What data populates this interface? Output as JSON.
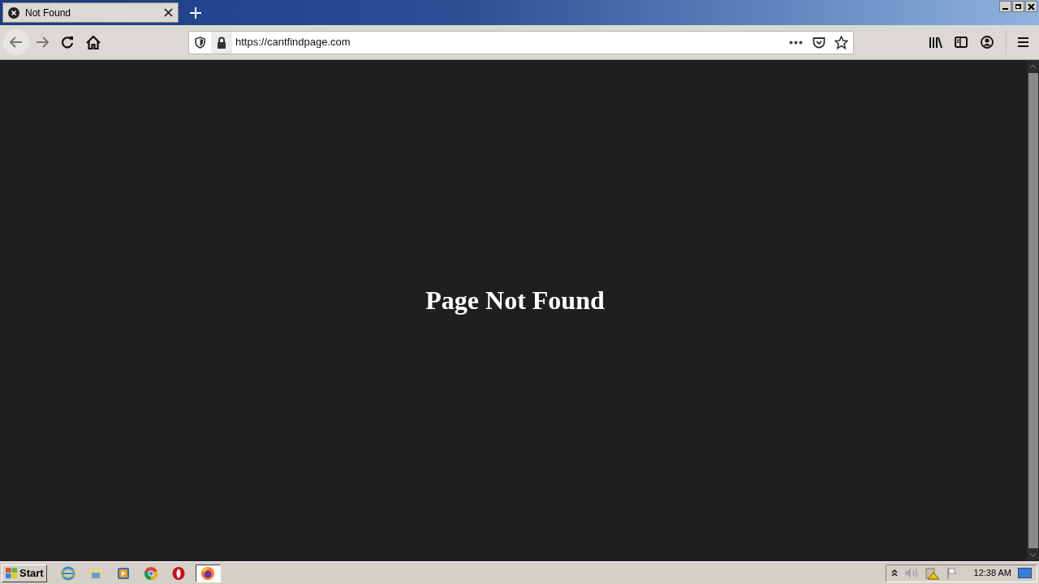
{
  "tab": {
    "title": "Not Found"
  },
  "address_bar": {
    "url": "https://cantfindpage.com"
  },
  "page": {
    "heading": "Page Not Found"
  },
  "taskbar": {
    "start": "Start",
    "apps": [
      {
        "kind": "ie",
        "selected": false
      },
      {
        "kind": "explorer",
        "selected": false
      },
      {
        "kind": "media",
        "selected": false
      },
      {
        "kind": "chrome",
        "selected": false
      },
      {
        "kind": "opera",
        "selected": false
      },
      {
        "kind": "firefox",
        "selected": true
      }
    ],
    "clock": "12:38 AM"
  }
}
